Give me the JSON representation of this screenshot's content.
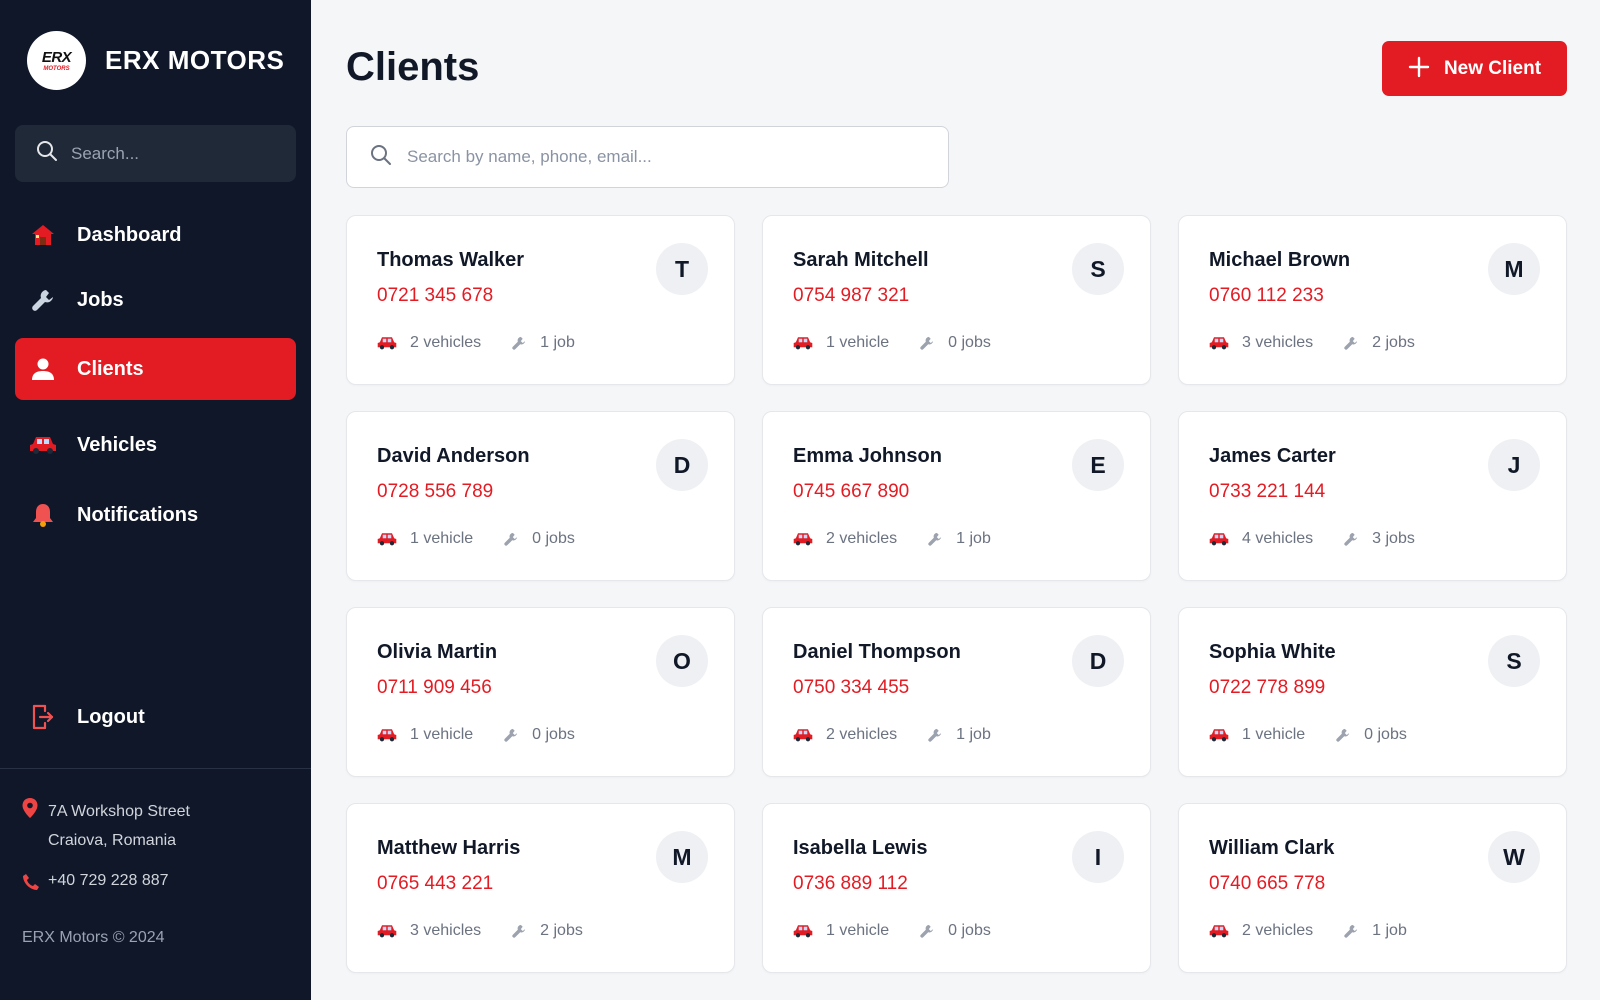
{
  "brand": {
    "logo_main": "ERX",
    "logo_sub": "MOTORS",
    "name_part1": "ERX",
    "name_part2": "MOTORS"
  },
  "sidebar": {
    "search_placeholder": "Search...",
    "items": [
      {
        "label": "Dashboard",
        "icon": "house-icon",
        "active": false
      },
      {
        "label": "Jobs",
        "icon": "wrench-icon",
        "active": false
      },
      {
        "label": "Clients",
        "icon": "user-icon",
        "active": true
      },
      {
        "label": "Vehicles",
        "icon": "car-icon",
        "active": false
      },
      {
        "label": "Notifications",
        "icon": "bell-icon",
        "active": false
      }
    ],
    "logout_label": "Logout",
    "address_line1": "7A Workshop Street",
    "address_line2": "Craiova, Romania",
    "phone": "+40 729 228 887",
    "copyright": "ERX Motors © 2024"
  },
  "main": {
    "title": "Clients",
    "new_client_label": "New Client",
    "search_placeholder": "Search by name, phone, email..."
  },
  "clients": [
    {
      "name": "Thomas Walker",
      "phone": "0721 345 678",
      "initial": "T",
      "vehicles": "2 vehicles",
      "jobs": "1 job"
    },
    {
      "name": "Sarah Mitchell",
      "phone": "0754 987 321",
      "initial": "S",
      "vehicles": "1 vehicle",
      "jobs": "0 jobs"
    },
    {
      "name": "Michael Brown",
      "phone": "0760 112 233",
      "initial": "M",
      "vehicles": "3 vehicles",
      "jobs": "2 jobs"
    },
    {
      "name": "David Anderson",
      "phone": "0728 556 789",
      "initial": "D",
      "vehicles": "1 vehicle",
      "jobs": "0 jobs"
    },
    {
      "name": "Emma Johnson",
      "phone": "0745 667 890",
      "initial": "E",
      "vehicles": "2 vehicles",
      "jobs": "1 job"
    },
    {
      "name": "James Carter",
      "phone": "0733 221 144",
      "initial": "J",
      "vehicles": "4 vehicles",
      "jobs": "3 jobs"
    },
    {
      "name": "Olivia Martin",
      "phone": "0711 909 456",
      "initial": "O",
      "vehicles": "1 vehicle",
      "jobs": "0 jobs"
    },
    {
      "name": "Daniel Thompson",
      "phone": "0750 334 455",
      "initial": "D",
      "vehicles": "2 vehicles",
      "jobs": "1 job"
    },
    {
      "name": "Sophia White",
      "phone": "0722 778 899",
      "initial": "S",
      "vehicles": "1 vehicle",
      "jobs": "0 jobs"
    },
    {
      "name": "Matthew Harris",
      "phone": "0765 443 221",
      "initial": "M",
      "vehicles": "3 vehicles",
      "jobs": "2 jobs"
    },
    {
      "name": "Isabella Lewis",
      "phone": "0736 889 112",
      "initial": "I",
      "vehicles": "1 vehicle",
      "jobs": "0 jobs"
    },
    {
      "name": "William Clark",
      "phone": "0740 665 778",
      "initial": "W",
      "vehicles": "2 vehicles",
      "jobs": "1 job"
    }
  ],
  "colors": {
    "sidebar_bg": "#0f1729",
    "accent_red": "#e31b23",
    "page_bg": "#f5f6f8"
  }
}
